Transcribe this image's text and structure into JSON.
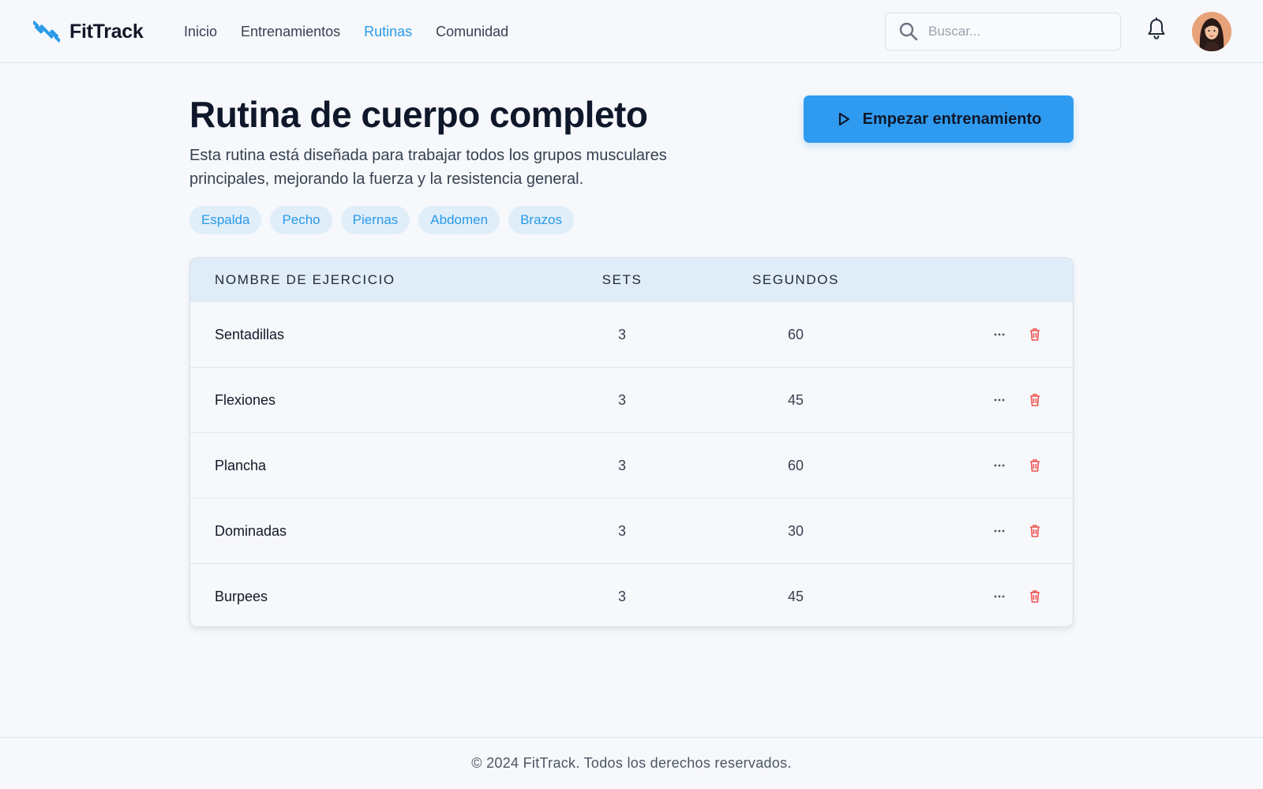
{
  "app": {
    "name": "FitTrack"
  },
  "nav": {
    "items": [
      {
        "label": "Inicio",
        "active": false
      },
      {
        "label": "Entrenamientos",
        "active": false
      },
      {
        "label": "Rutinas",
        "active": true
      },
      {
        "label": "Comunidad",
        "active": false
      }
    ]
  },
  "search": {
    "placeholder": "Buscar...",
    "value": ""
  },
  "routine": {
    "title": "Rutina de cuerpo completo",
    "description": "Esta rutina está diseñada para trabajar todos los grupos musculares principales, mejorando la fuerza y la resistencia general.",
    "start_label": "Empezar entrenamiento",
    "tags": [
      "Espalda",
      "Pecho",
      "Piernas",
      "Abdomen",
      "Brazos"
    ]
  },
  "table": {
    "headers": {
      "name": "NOMBRE DE EJERCICIO",
      "sets": "SETS",
      "seconds": "SEGUNDOS"
    },
    "rows": [
      {
        "name": "Sentadillas",
        "sets": "3",
        "seconds": "60"
      },
      {
        "name": "Flexiones",
        "sets": "3",
        "seconds": "45"
      },
      {
        "name": "Plancha",
        "sets": "3",
        "seconds": "60"
      },
      {
        "name": "Dominadas",
        "sets": "3",
        "seconds": "30"
      },
      {
        "name": "Burpees",
        "sets": "3",
        "seconds": "45"
      }
    ]
  },
  "footer": {
    "text": "© 2024 FitTrack. Todos los derechos reservados."
  },
  "colors": {
    "accent": "#2a9ae8",
    "primary_button": "#2f9bf0",
    "tag_bg": "#e0eefa",
    "delete": "#f05252",
    "table_header_bg": "#e0edf8"
  },
  "icons": {
    "logo": "dumbbell-icon",
    "search": "search-icon",
    "notifications": "bell-icon",
    "start": "play-icon",
    "row_more": "more-horizontal-icon",
    "row_delete": "trash-icon"
  }
}
